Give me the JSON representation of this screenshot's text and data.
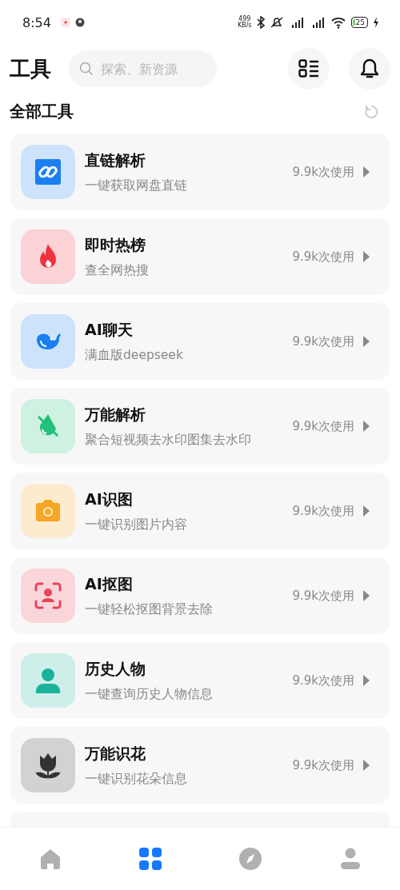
{
  "status_bar": {
    "time": "8:54",
    "speed": "499",
    "speed_unit": "KB/s",
    "battery": "25"
  },
  "header": {
    "title": "工具",
    "search": {
      "placeholder": "探索、新资源"
    }
  },
  "section": {
    "title": "全部工具"
  },
  "tools": [
    {
      "kind": "link",
      "color": "#1a7ff0",
      "name": "直链解析",
      "desc": "一键获取网盘直链",
      "usage": "9.9k次使用"
    },
    {
      "kind": "flame",
      "color": "#ef3340",
      "name": "即时热榜",
      "desc": "查全网热搜",
      "usage": "9.9k次使用"
    },
    {
      "kind": "whale",
      "color": "#1a7ff0",
      "name": "AI聊天",
      "desc": "满血版deepseek",
      "usage": "9.9k次使用"
    },
    {
      "kind": "drop",
      "color": "#22c07a",
      "name": "万能解析",
      "desc": "聚合短视频去水印图集去水印",
      "usage": "9.9k次使用"
    },
    {
      "kind": "camera",
      "color": "#f5a623",
      "name": "AI识图",
      "desc": "一键识别图片内容",
      "usage": "9.9k次使用"
    },
    {
      "kind": "face",
      "color": "#e8455a",
      "name": "AI抠图",
      "desc": "一键轻松抠图背景去除",
      "usage": "9.9k次使用"
    },
    {
      "kind": "person",
      "color": "#1ab39a",
      "name": "历史人物",
      "desc": "一键查询历史人物信息",
      "usage": "9.9k次使用"
    },
    {
      "kind": "flower",
      "color": "#333333",
      "name": "万能识花",
      "desc": "一键识别花朵信息",
      "usage": "9.9k次使用"
    }
  ],
  "nav": [
    {
      "kind": "home",
      "selected": false
    },
    {
      "kind": "grid",
      "selected": true
    },
    {
      "kind": "compass",
      "selected": false
    },
    {
      "kind": "user",
      "selected": false
    }
  ]
}
